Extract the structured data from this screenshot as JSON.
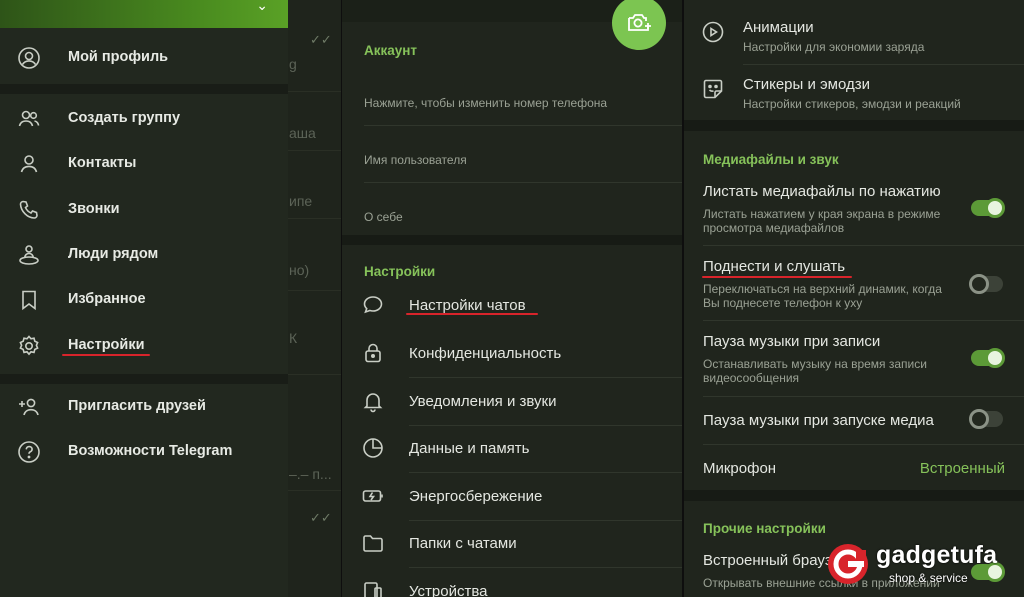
{
  "drawer": {
    "items": [
      {
        "label": "Мой профиль",
        "icon": "profile-icon"
      },
      {
        "label": "Создать группу",
        "icon": "group-icon"
      },
      {
        "label": "Контакты",
        "icon": "contact-icon"
      },
      {
        "label": "Звонки",
        "icon": "phone-icon"
      },
      {
        "label": "Люди рядом",
        "icon": "people-nearby-icon"
      },
      {
        "label": "Избранное",
        "icon": "bookmark-icon"
      },
      {
        "label": "Настройки",
        "icon": "gear-icon"
      },
      {
        "label": "Пригласить друзей",
        "icon": "add-user-icon"
      },
      {
        "label": "Возможности Telegram",
        "icon": "help-icon"
      }
    ],
    "chat_fragments": [
      "g",
      "аша",
      "ипе",
      "но)",
      "К",
      "–.– п..."
    ]
  },
  "account": {
    "section_title": "Аккаунт",
    "phone_hint": "Нажмите, чтобы изменить номер телефона",
    "username_hint": "Имя пользователя",
    "bio_hint": "О себе"
  },
  "settings": {
    "section_title": "Настройки",
    "items": [
      {
        "label": "Настройки чатов",
        "icon": "chat-bubble-icon"
      },
      {
        "label": "Конфиденциальность",
        "icon": "lock-icon"
      },
      {
        "label": "Уведомления и звуки",
        "icon": "bell-icon"
      },
      {
        "label": "Данные и память",
        "icon": "pie-chart-icon"
      },
      {
        "label": "Энергосбережение",
        "icon": "battery-icon"
      },
      {
        "label": "Папки с чатами",
        "icon": "folder-icon"
      },
      {
        "label": "Устройства",
        "icon": "devices-icon"
      }
    ]
  },
  "media": {
    "animations": {
      "title": "Анимации",
      "subtitle": "Настройки для экономии заряда"
    },
    "stickers": {
      "title": "Стикеры и эмодзи",
      "subtitle": "Настройки стикеров, эмодзи и реакций"
    },
    "section_title": "Медиафайлы и звук",
    "rows": [
      {
        "title": "Листать медиафайлы по нажатию",
        "subtitle": [
          "Листать нажатием у края экрана в режиме",
          "просмотра медиафайлов"
        ],
        "on": true
      },
      {
        "title": "Поднести и слушать",
        "subtitle": [
          "Переключаться на верхний динамик, когда",
          "Вы поднесете телефон к уху"
        ],
        "on": false
      },
      {
        "title": "Пауза музыки при записи",
        "subtitle": [
          "Останавливать музыку на время записи",
          "видеосообщения"
        ],
        "on": true
      },
      {
        "title": "Пауза музыки при запуске медиа",
        "on": false
      }
    ],
    "microphone": {
      "title": "Микрофон",
      "value": "Встроенный"
    },
    "other_title": "Прочие настройки",
    "browser": {
      "title": "Встроенный браузер",
      "subtitle": "Открывать внешние ссылки в приложении",
      "on": true
    }
  },
  "watermark": {
    "brand": "gadgetufa",
    "tagline": "shop & service"
  },
  "colors": {
    "accent": "#86c25a",
    "underline": "#d8242b",
    "toggle_on": "#5c9a37"
  }
}
